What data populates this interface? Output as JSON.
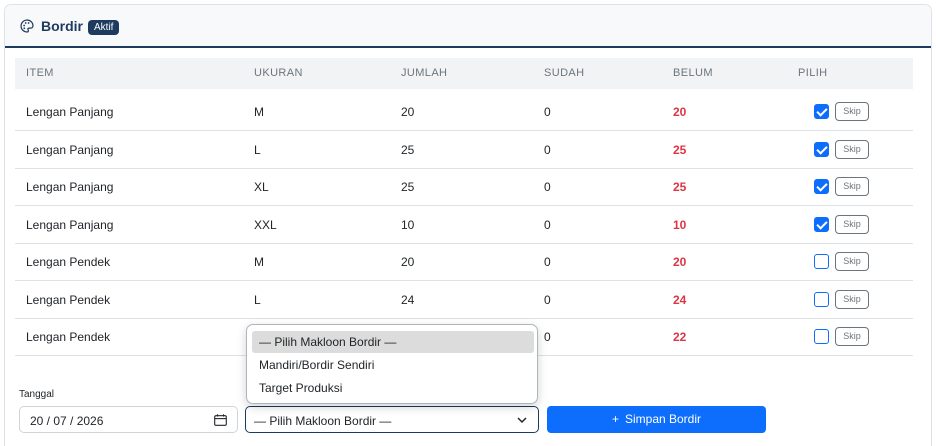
{
  "header": {
    "title": "Bordir",
    "badge": "Aktif",
    "icon": "palette-icon"
  },
  "table": {
    "columns": [
      "ITEM",
      "UKURAN",
      "JUMLAH",
      "SUDAH",
      "BELUM",
      "PILIH"
    ],
    "skip_label": "Skip",
    "rows": [
      {
        "item": "Lengan Panjang",
        "ukuran": "M",
        "jumlah": "20",
        "sudah": "0",
        "belum": "20",
        "checked": true
      },
      {
        "item": "Lengan Panjang",
        "ukuran": "L",
        "jumlah": "25",
        "sudah": "0",
        "belum": "25",
        "checked": true
      },
      {
        "item": "Lengan Panjang",
        "ukuran": "XL",
        "jumlah": "25",
        "sudah": "0",
        "belum": "25",
        "checked": true
      },
      {
        "item": "Lengan Panjang",
        "ukuran": "XXL",
        "jumlah": "10",
        "sudah": "0",
        "belum": "10",
        "checked": true
      },
      {
        "item": "Lengan Pendek",
        "ukuran": "M",
        "jumlah": "20",
        "sudah": "0",
        "belum": "20",
        "checked": false
      },
      {
        "item": "Lengan Pendek",
        "ukuran": "L",
        "jumlah": "24",
        "sudah": "0",
        "belum": "24",
        "checked": false
      },
      {
        "item": "Lengan Pendek",
        "ukuran": "",
        "jumlah": "",
        "sudah": "0",
        "belum": "22",
        "checked": false
      }
    ]
  },
  "form": {
    "tanggal_label": "Tanggal",
    "tanggal_value": "20 / 07 / 2026",
    "makloon_selected": "— Pilih Makloon Bordir —",
    "makloon_options": [
      "— Pilih Makloon Bordir —",
      "Mandiri/Bordir Sendiri",
      "Target Produksi"
    ],
    "save_label": "Simpan Bordir",
    "save_icon": "plus-icon"
  },
  "colors": {
    "primary": "#0d6efd",
    "navy": "#1e3a5f",
    "danger": "#dc3545"
  }
}
